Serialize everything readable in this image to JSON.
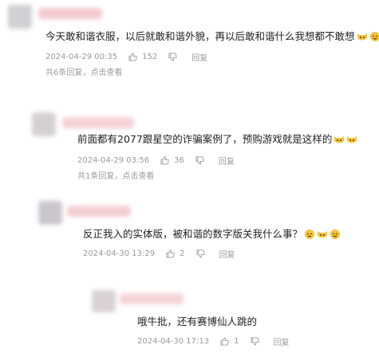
{
  "comments": [
    {
      "text": "今天敢和谐衣服，以后就敢和谐外貌，再以后敢和谐什么我想都不敢想",
      "timestamp": "2024-04-29 00:35",
      "likes": "152",
      "reply_label": "回复",
      "thread": "共6条回复，点击查看",
      "emojis": [
        "cat-face-icon",
        "laughing-face-icon"
      ]
    },
    {
      "text": "前面都有2077跟星空的诈骗案例了，预购游戏就是这样的",
      "timestamp": "2024-04-29 03:56",
      "likes": "36",
      "reply_label": "回复",
      "thread": "共1条回复，点击查看",
      "emojis": [
        "cat-face-icon",
        "cat-face-icon"
      ]
    },
    {
      "text": "反正我入的实体版，被和谐的数字版关我什么事？",
      "timestamp": "2024-04-30 13:29",
      "likes": "2",
      "reply_label": "回复",
      "emojis": [
        "laughing-face-icon",
        "cat-face-icon",
        "laughing-face-icon"
      ]
    },
    {
      "text": "哦牛批，还有赛博仙人跳的",
      "timestamp": "2024-04-30 17:13",
      "likes": "1",
      "reply_label": "回复",
      "emojis": []
    }
  ],
  "colors": {
    "meta": "#9a9a9a",
    "text": "#1f1f1f",
    "emoji": "#f6c23e"
  }
}
